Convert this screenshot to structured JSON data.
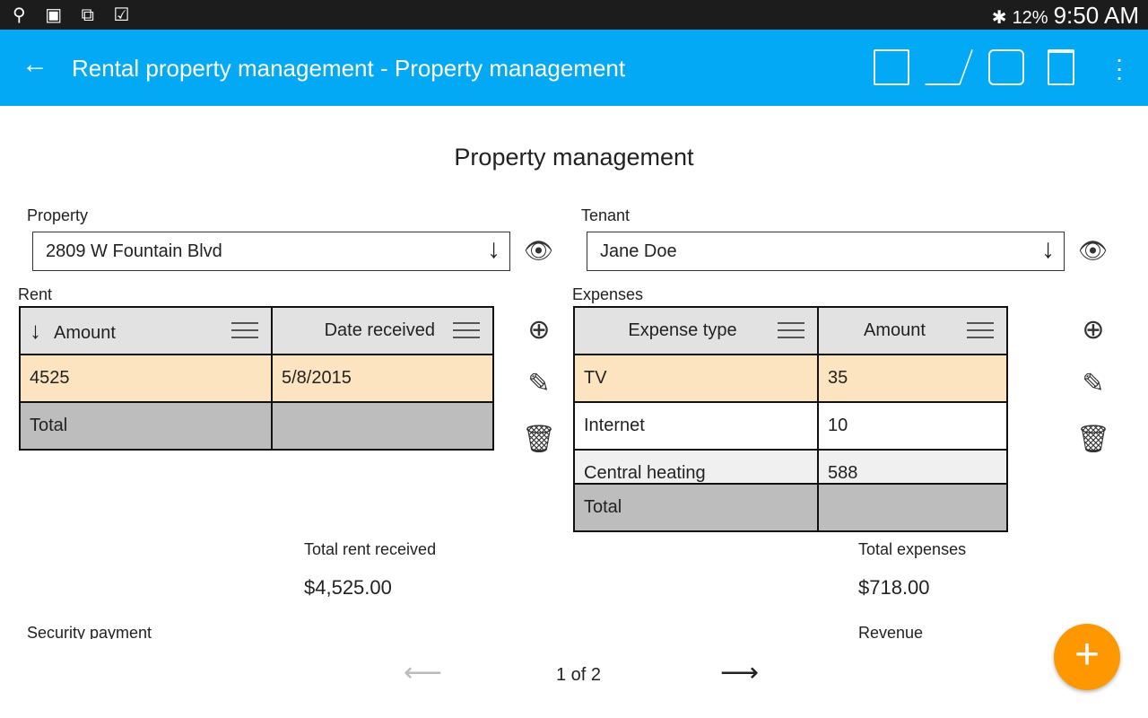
{
  "status": {
    "left_icons": "⚲ ▣ ⧉ ☑",
    "battery": "12%",
    "time": "9:50 AM"
  },
  "appbar": {
    "title": "Rental property management - Property management",
    "back": "←"
  },
  "page_title": "Property management",
  "property": {
    "label": "Property",
    "value": "2809 W Fountain Blvd"
  },
  "tenant": {
    "label": "Tenant",
    "value": "Jane Doe"
  },
  "rent": {
    "label": "Rent",
    "columns": [
      "Amount",
      "Date received"
    ],
    "rows": [
      [
        "4525",
        "5/8/2015"
      ]
    ],
    "total_label": "Total"
  },
  "expenses": {
    "label": "Expenses",
    "columns": [
      "Expense type",
      "Amount"
    ],
    "rows": [
      [
        "TV",
        "35"
      ],
      [
        "Internet",
        "10"
      ],
      [
        "Central heating",
        "588"
      ]
    ],
    "total_label": "Total"
  },
  "summary": {
    "total_rent_label": "Total rent received",
    "total_rent": "$4,525.00",
    "total_expenses_label": "Total expenses",
    "total_expenses": "$718.00",
    "security_label": "Security payment",
    "revenue_label": "Revenue"
  },
  "pager": {
    "text": "1 of 2"
  },
  "colors": {
    "appbar": "#03a9f4",
    "fab": "#ff9800",
    "selected_row": "#fde4c0"
  }
}
